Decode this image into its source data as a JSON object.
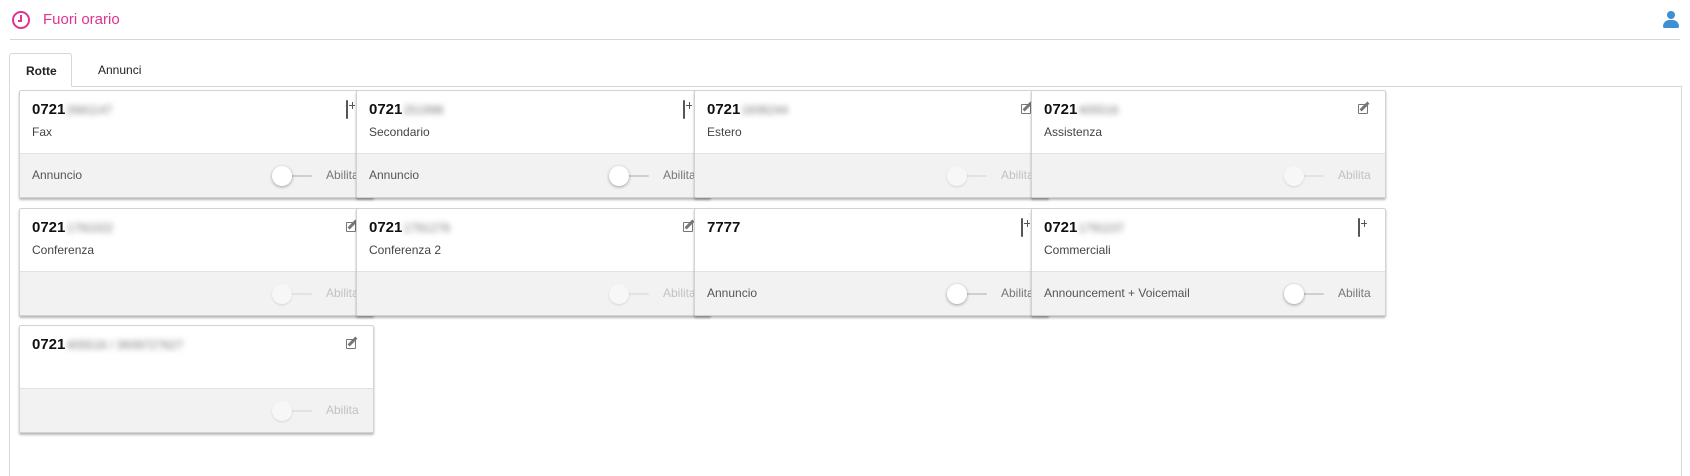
{
  "header": {
    "title": "Fuori orario",
    "icon": "clock-icon",
    "user_icon": "user-icon",
    "accent": "#e0338f"
  },
  "tabs": [
    {
      "label": "Rotte",
      "active": true
    },
    {
      "label": "Annunci",
      "active": false
    }
  ],
  "cards": [
    {
      "prefix": "0721",
      "masked": "2681147",
      "label": "Fax",
      "action_icon": "plus-square-icon",
      "foot_label": "Annuncio",
      "toggle_label": "Abilita",
      "enabled": true
    },
    {
      "prefix": "0721",
      "masked": "251998",
      "label": "Secondario",
      "action_icon": "plus-square-icon",
      "foot_label": "Annuncio",
      "toggle_label": "Abilita",
      "enabled": true
    },
    {
      "prefix": "0721",
      "masked": "1836244",
      "label": "Estero",
      "action_icon": "edit-icon",
      "foot_label": "",
      "toggle_label": "Abilita",
      "enabled": false
    },
    {
      "prefix": "0721",
      "masked": "405516",
      "label": "Assistenza",
      "action_icon": "edit-icon",
      "foot_label": "",
      "toggle_label": "Abilita",
      "enabled": false
    },
    {
      "prefix": "0721",
      "masked": "1791022",
      "label": "Conferenza",
      "action_icon": "edit-icon",
      "foot_label": "",
      "toggle_label": "Abilita",
      "enabled": false
    },
    {
      "prefix": "0721",
      "masked": "1791276",
      "label": "Conferenza 2",
      "action_icon": "edit-icon",
      "foot_label": "",
      "toggle_label": "Abilita",
      "enabled": false
    },
    {
      "prefix": "7777",
      "masked": "",
      "label": "",
      "action_icon": "plus-square-icon",
      "foot_label": "Annuncio",
      "toggle_label": "Abilita",
      "enabled": true
    },
    {
      "prefix": "0721",
      "masked": "1791107",
      "label": "Commerciali",
      "action_icon": "plus-square-icon",
      "foot_label": "Announcement + Voicemail",
      "toggle_label": "Abilita",
      "enabled": true
    },
    {
      "prefix": "0721",
      "masked": "405516 / 3939727627",
      "label": "",
      "action_icon": "edit-icon",
      "foot_label": "",
      "toggle_label": "Abilita",
      "enabled": false
    }
  ]
}
